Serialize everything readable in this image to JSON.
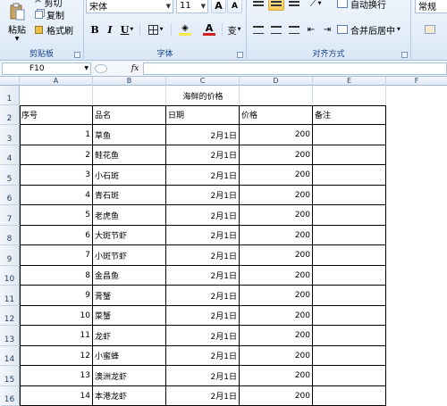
{
  "ribbon": {
    "clipboard": {
      "cut_label": "剪切",
      "copy_label": "复制",
      "format_painter_label": "格式刷",
      "paste_label": "粘贴",
      "group_label": "剪贴板"
    },
    "font": {
      "font_name": "宋体",
      "font_size": "11",
      "bold_label": "B",
      "italic_label": "I",
      "underline_label": "U",
      "grow_label": "A",
      "shrink_label": "A",
      "font_color_label": "A",
      "phonetic_label": "变",
      "group_label": "字体"
    },
    "alignment": {
      "wrap_label": "自动换行",
      "merge_label": "合并后居中",
      "group_label": "对齐方式"
    },
    "number": {
      "format_value": "常规"
    }
  },
  "formula_bar": {
    "name_box": "F10",
    "fx_label": "fx",
    "formula": ""
  },
  "sheet": {
    "columns": [
      "A",
      "B",
      "C",
      "D",
      "E",
      "F"
    ],
    "row_numbers": [
      "1",
      "2",
      "3",
      "4",
      "5",
      "6",
      "7",
      "8",
      "9",
      "10",
      "11",
      "12",
      "13",
      "14",
      "15",
      "16"
    ],
    "title": "海鲜的价格",
    "headers": [
      "序号",
      "品名",
      "日期",
      "价格",
      "备注"
    ],
    "rows": [
      {
        "no": "1",
        "name": "草鱼",
        "date": "2月1日",
        "price": "200",
        "note": ""
      },
      {
        "no": "2",
        "name": "鲑花鱼",
        "date": "2月1日",
        "price": "200",
        "note": ""
      },
      {
        "no": "3",
        "name": "小石斑",
        "date": "2月1日",
        "price": "200",
        "note": ""
      },
      {
        "no": "4",
        "name": "青石斑",
        "date": "2月1日",
        "price": "200",
        "note": ""
      },
      {
        "no": "5",
        "name": "老虎鱼",
        "date": "2月1日",
        "price": "200",
        "note": ""
      },
      {
        "no": "6",
        "name": "大斑节虾",
        "date": "2月1日",
        "price": "200",
        "note": ""
      },
      {
        "no": "7",
        "name": "小斑节虾",
        "date": "2月1日",
        "price": "200",
        "note": ""
      },
      {
        "no": "8",
        "name": "金昌鱼",
        "date": "2月1日",
        "price": "200",
        "note": ""
      },
      {
        "no": "9",
        "name": "膏蟹",
        "date": "2月1日",
        "price": "200",
        "note": ""
      },
      {
        "no": "10",
        "name": "菜蟹",
        "date": "2月1日",
        "price": "200",
        "note": ""
      },
      {
        "no": "11",
        "name": "龙虾",
        "date": "2月1日",
        "price": "200",
        "note": ""
      },
      {
        "no": "12",
        "name": "小蜜蜂",
        "date": "2月1日",
        "price": "200",
        "note": ""
      },
      {
        "no": "13",
        "name": "澳洲龙虾",
        "date": "2月1日",
        "price": "200",
        "note": ""
      },
      {
        "no": "14",
        "name": "本港龙虾",
        "date": "2月1日",
        "price": "200",
        "note": ""
      }
    ]
  },
  "colors": {
    "ribbon_text": "#15428b",
    "fill_color": "#f5e84a",
    "font_color": "#d42020",
    "gridline": "#d4dce8"
  }
}
